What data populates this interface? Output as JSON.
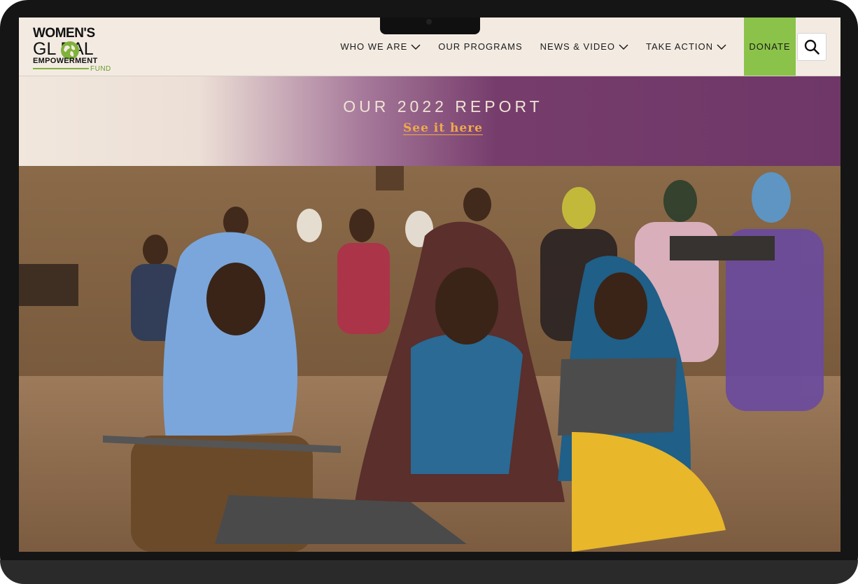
{
  "logo": {
    "line1": "WOMEN'S",
    "line2": "GL   BAL",
    "line3": "EMPOWERMENT",
    "line4": "FUND"
  },
  "nav": {
    "items": [
      {
        "label": "WHO WE ARE",
        "has_dropdown": true
      },
      {
        "label": "OUR PROGRAMS",
        "has_dropdown": false
      },
      {
        "label": "NEWS & VIDEO",
        "has_dropdown": true
      },
      {
        "label": "TAKE ACTION",
        "has_dropdown": true
      }
    ],
    "donate_label": "DONATE",
    "search_icon": "search-icon"
  },
  "banner": {
    "title": "OUR 2022 REPORT",
    "link": "See it here"
  },
  "hero": {
    "image": "photo-women-learning-with-chalk-slates"
  },
  "colors": {
    "header_bg": "#f3ebe2",
    "donate_bg": "#8bc34a",
    "banner_purple": "#6e3767",
    "banner_link": "#f0a94a",
    "logo_green": "#6a9c2c"
  }
}
